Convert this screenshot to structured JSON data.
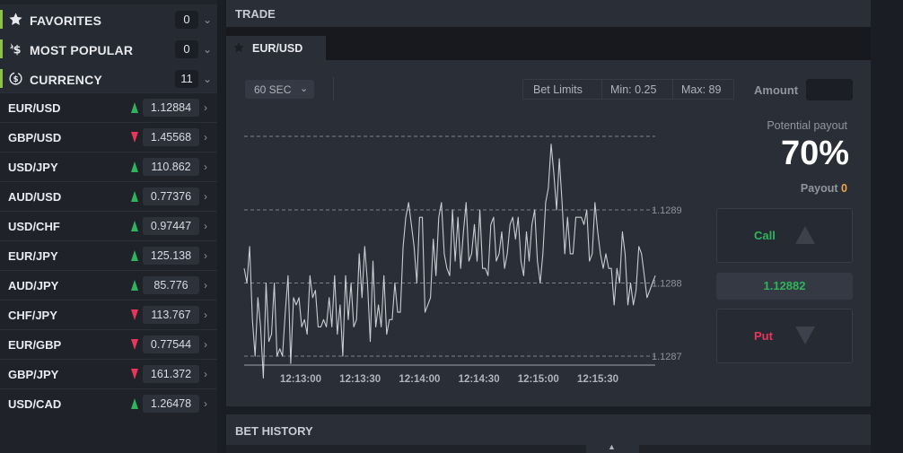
{
  "sidebar": {
    "categories": [
      {
        "label": "FAVORITES",
        "count": "0",
        "icon": "star-icon"
      },
      {
        "label": "MOST POPULAR",
        "count": "0",
        "icon": "hot-dollar-icon"
      },
      {
        "label": "CURRENCY",
        "count": "11",
        "icon": "currency-exchange-icon"
      }
    ],
    "pairs": [
      {
        "label": "EUR/USD",
        "value": "1.12884",
        "trend": "up"
      },
      {
        "label": "GBP/USD",
        "value": "1.45568",
        "trend": "down"
      },
      {
        "label": "USD/JPY",
        "value": "110.862",
        "trend": "up"
      },
      {
        "label": "AUD/USD",
        "value": "0.77376",
        "trend": "up"
      },
      {
        "label": "USD/CHF",
        "value": "0.97447",
        "trend": "up"
      },
      {
        "label": "EUR/JPY",
        "value": "125.138",
        "trend": "up"
      },
      {
        "label": "AUD/JPY",
        "value": "85.776",
        "trend": "up"
      },
      {
        "label": "CHF/JPY",
        "value": "113.767",
        "trend": "down"
      },
      {
        "label": "EUR/GBP",
        "value": "0.77544",
        "trend": "down"
      },
      {
        "label": "GBP/JPY",
        "value": "161.372",
        "trend": "down"
      },
      {
        "label": "USD/CAD",
        "value": "1.26478",
        "trend": "up"
      }
    ]
  },
  "trade": {
    "title": "TRADE",
    "tab_label": "EUR/USD",
    "time_select": "60 SEC",
    "bet_limits_label": "Bet Limits",
    "min_label": "Min: 0.25",
    "max_label": "Max: 89",
    "amount_label": "Amount",
    "amount_value": "",
    "payout_title": "Potential payout",
    "payout_percent": "70%",
    "payout_label": "Payout",
    "payout_value": "0",
    "call_label": "Call",
    "put_label": "Put",
    "current_price": "1.12882"
  },
  "history": {
    "title": "BET HISTORY"
  },
  "colors": {
    "up": "#2fb35c",
    "down": "#e8365b",
    "accent_bar": "#8bc34a",
    "payout_value": "#f0a44a"
  },
  "chart_data": {
    "type": "line",
    "x_ticks": [
      "12:13:00",
      "12:13:30",
      "12:14:00",
      "12:14:30",
      "12:15:00",
      "12:15:30"
    ],
    "y_ticks": [
      "1.1289",
      "1.1288",
      "1.1287"
    ],
    "ylim": [
      1.12865,
      1.12905
    ],
    "series": [
      {
        "values": [
          1.12882,
          1.1288,
          1.12885,
          1.12875,
          1.1287,
          1.12878,
          1.12874,
          1.12867,
          1.1288,
          1.12872,
          1.12873,
          1.1288,
          1.1287,
          1.12871,
          1.1287,
          1.12876,
          1.12881,
          1.12869,
          1.12878,
          1.12877,
          1.12878,
          1.12874,
          1.12875,
          1.12873,
          1.12881,
          1.12878,
          1.12879,
          1.12874,
          1.12874,
          1.12875,
          1.12874,
          1.12878,
          1.12874,
          1.12881,
          1.12873,
          1.12877,
          1.1287,
          1.12881,
          1.12875,
          1.1288,
          1.12874,
          1.12875,
          1.12884,
          1.12878,
          1.12885,
          1.1288,
          1.12872,
          1.12883,
          1.12874,
          1.12877,
          1.12874,
          1.12881,
          1.12873,
          1.12875,
          1.12875,
          1.1288,
          1.12876,
          1.12876,
          1.12885,
          1.12889,
          1.12891,
          1.12888,
          1.12885,
          1.1288,
          1.12889,
          1.12889,
          1.12876,
          1.12877,
          1.12878,
          1.12886,
          1.12881,
          1.12889,
          1.12891,
          1.12884,
          1.12882,
          1.12881,
          1.1289,
          1.12883,
          1.12889,
          1.12882,
          1.12887,
          1.12891,
          1.12883,
          1.12884,
          1.12888,
          1.12883,
          1.1289,
          1.12882,
          1.12882,
          1.12881,
          1.12888,
          1.12889,
          1.12883,
          1.12884,
          1.12887,
          1.12882,
          1.12884,
          1.12888,
          1.12889,
          1.12886,
          1.12889,
          1.12883,
          1.12881,
          1.12887,
          1.12883,
          1.12888,
          1.1289,
          1.12883,
          1.1288,
          1.12884,
          1.12891,
          1.12893,
          1.12899,
          1.12895,
          1.1289,
          1.12897,
          1.12891,
          1.12884,
          1.12889,
          1.12884,
          1.12884,
          1.12889,
          1.12889,
          1.12889,
          1.12888,
          1.1289,
          1.12883,
          1.12884,
          1.12891,
          1.12887,
          1.12884,
          1.12882,
          1.12884,
          1.12882,
          1.12882,
          1.12877,
          1.12882,
          1.1288,
          1.12887,
          1.12884,
          1.12877,
          1.1288,
          1.12877,
          1.12879,
          1.12885,
          1.12884,
          1.12881,
          1.12878,
          1.12879,
          1.1288,
          1.12881
        ]
      }
    ],
    "grid": "dashed horizontal lines at tick values"
  }
}
